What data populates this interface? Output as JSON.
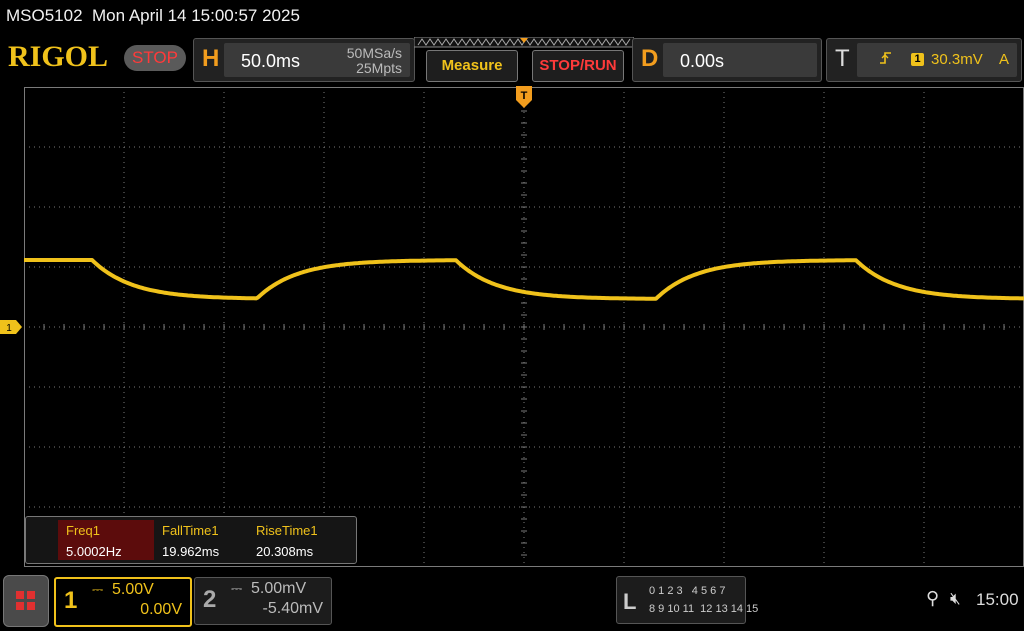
{
  "title": "MSO5102  Mon April 14 15:00:57 2025",
  "brand": "RIGOL",
  "run_status": "STOP",
  "horizontal": {
    "letter": "H",
    "timebase": "50.0ms",
    "sample_rate": "50MSa/s",
    "memory_depth": "25Mpts"
  },
  "buttons": {
    "measure": "Measure",
    "stop_run": "STOP/RUN"
  },
  "delay": {
    "letter": "D",
    "value": "0.00s"
  },
  "trigger": {
    "letter": "T",
    "source": "1",
    "level": "30.3mV",
    "mode": "A",
    "position_marker": "T"
  },
  "measurements": [
    {
      "name": "Freq1",
      "value": "5.0002Hz"
    },
    {
      "name": "FallTime1",
      "value": "19.962ms"
    },
    {
      "name": "RiseTime1",
      "value": "20.308ms"
    }
  ],
  "channel1": {
    "number": "1",
    "scale": "5.00V",
    "offset": "0.00V",
    "marker": "1",
    "coupling_icon": "dc-coupling-icon"
  },
  "channel2": {
    "number": "2",
    "scale": "5.00mV",
    "offset": "-5.40mV",
    "coupling_icon": "dc-coupling-icon"
  },
  "logic": {
    "letter": "L",
    "row1": "0 1 2 3   4 5 6 7",
    "row2": "8 9 10 11  12 13 14 15"
  },
  "status": {
    "time": "15:00",
    "usb_icon": "usb-icon",
    "speaker_icon": "speaker-muted-icon"
  },
  "colors": {
    "ch1": "#f0c21b",
    "background": "#000000",
    "grid": "#7a7a7a",
    "accent_orange": "#f29d1e",
    "stop_red": "#ff3a3a"
  }
}
